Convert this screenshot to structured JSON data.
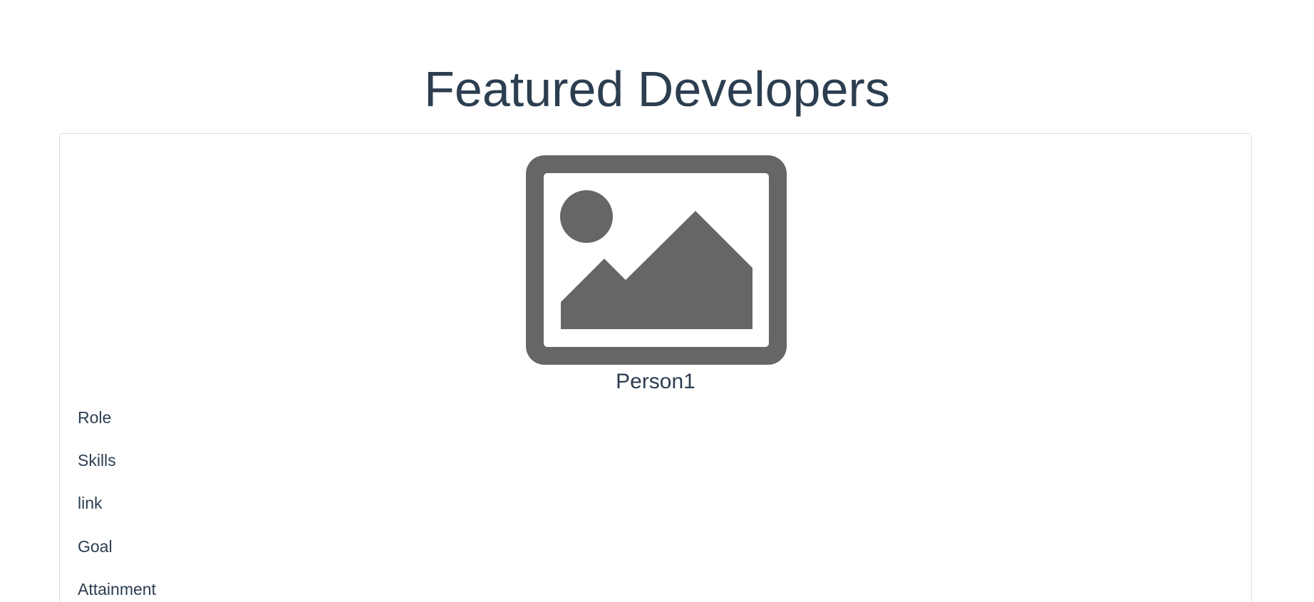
{
  "page": {
    "title": "Featured Developers"
  },
  "developer": {
    "name": "Person1",
    "image_icon": "image-placeholder-icon",
    "fields": [
      "Role",
      "Skills",
      "link",
      "Goal",
      "Attainment"
    ]
  },
  "colors": {
    "text": "#2c3e50",
    "placeholder_gray": "#666666",
    "card_border": "#dcdfe3"
  }
}
